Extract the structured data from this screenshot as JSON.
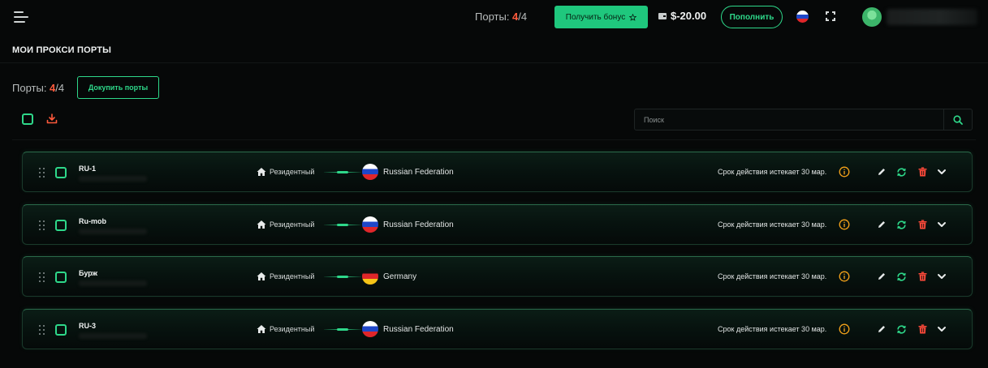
{
  "header": {
    "ports_label": "Порты: ",
    "ports_used": "4",
    "ports_total": "/4",
    "bonus_label": "Получить бонус",
    "bonus_icon": "star-icon",
    "wallet_icon": "wallet-icon",
    "balance": "$-20.00",
    "topup_label": "Пополнить",
    "language_flag": "russia-flag-icon"
  },
  "page": {
    "title": "МОИ ПРОКСИ ПОРТЫ",
    "ports_label": "Порты: ",
    "ports_used": "4",
    "ports_total": "/4",
    "buy_label": "Докупить порты",
    "search_placeholder": "Поиск"
  },
  "colors": {
    "accent": "#2ed88a",
    "button_fill": "#1fc77d",
    "danger": "#ff5a3c",
    "warning": "#f4a21a",
    "background": "#060808"
  },
  "ports": [
    {
      "name": "RU-1",
      "type": "Резидентный",
      "country": "Russian Federation",
      "flag": "russia",
      "expires": "Срок действия истекает 30 мар."
    },
    {
      "name": "Ru-mob",
      "type": "Резидентный",
      "country": "Russian Federation",
      "flag": "russia",
      "expires": "Срок действия истекает 30 мар."
    },
    {
      "name": "Бурж",
      "type": "Резидентный",
      "country": "Germany",
      "flag": "germany",
      "expires": "Срок действия истекает 30 мар."
    },
    {
      "name": "RU-3",
      "type": "Резидентный",
      "country": "Russian Federation",
      "flag": "russia",
      "expires": "Срок действия истекает 30 мар."
    }
  ]
}
